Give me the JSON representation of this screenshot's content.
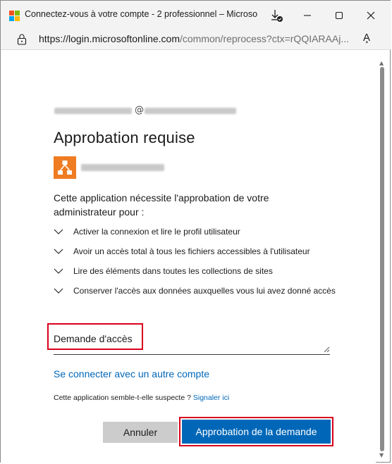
{
  "window": {
    "title": "Connectez-vous à votre compte - 2 professionnel – Microsoft...",
    "icons": [
      "microsoft-logo-icon",
      "download-icon",
      "minimize-icon",
      "maximize-icon",
      "close-icon"
    ],
    "logo_colors": [
      "#f25022",
      "#7fba00",
      "#00a4ef",
      "#ffb900"
    ]
  },
  "address_bar": {
    "url_host": "https://login.microsoftonline.com",
    "url_rest": "/common/reprocess?ctx=rQQIARAAj...",
    "icons": [
      "lock-icon",
      "read-aloud-icon"
    ],
    "read_aloud_glyph": "A̧"
  },
  "dialog": {
    "at_sign": "@",
    "heading": "Approbation requise",
    "intro": "Cette application nécessite l'approbation de votre administrateur pour :",
    "permissions": [
      "Activer la connexion et lire le profil utilisateur",
      "Avoir un accès total à tous les fichiers accessibles à l'utilisateur",
      "Lire des éléments dans toutes les collections de sites",
      "Conserver l'accès aux données auxquelles vous lui avez donné accès"
    ],
    "justification_value": "Demande d'accès",
    "other_account_link": "Se connecter avec un autre compte",
    "suspect_text": "Cette application semble-t-elle suspecte ?",
    "report_link": "Signaler ici",
    "cancel_label": "Annuler",
    "approve_label": "Approbation de la demande"
  },
  "colors": {
    "accent": "#0067b8",
    "app_tile": "#ef7c22",
    "highlight": "#d9001b",
    "cancel_bg": "#cccccc"
  }
}
